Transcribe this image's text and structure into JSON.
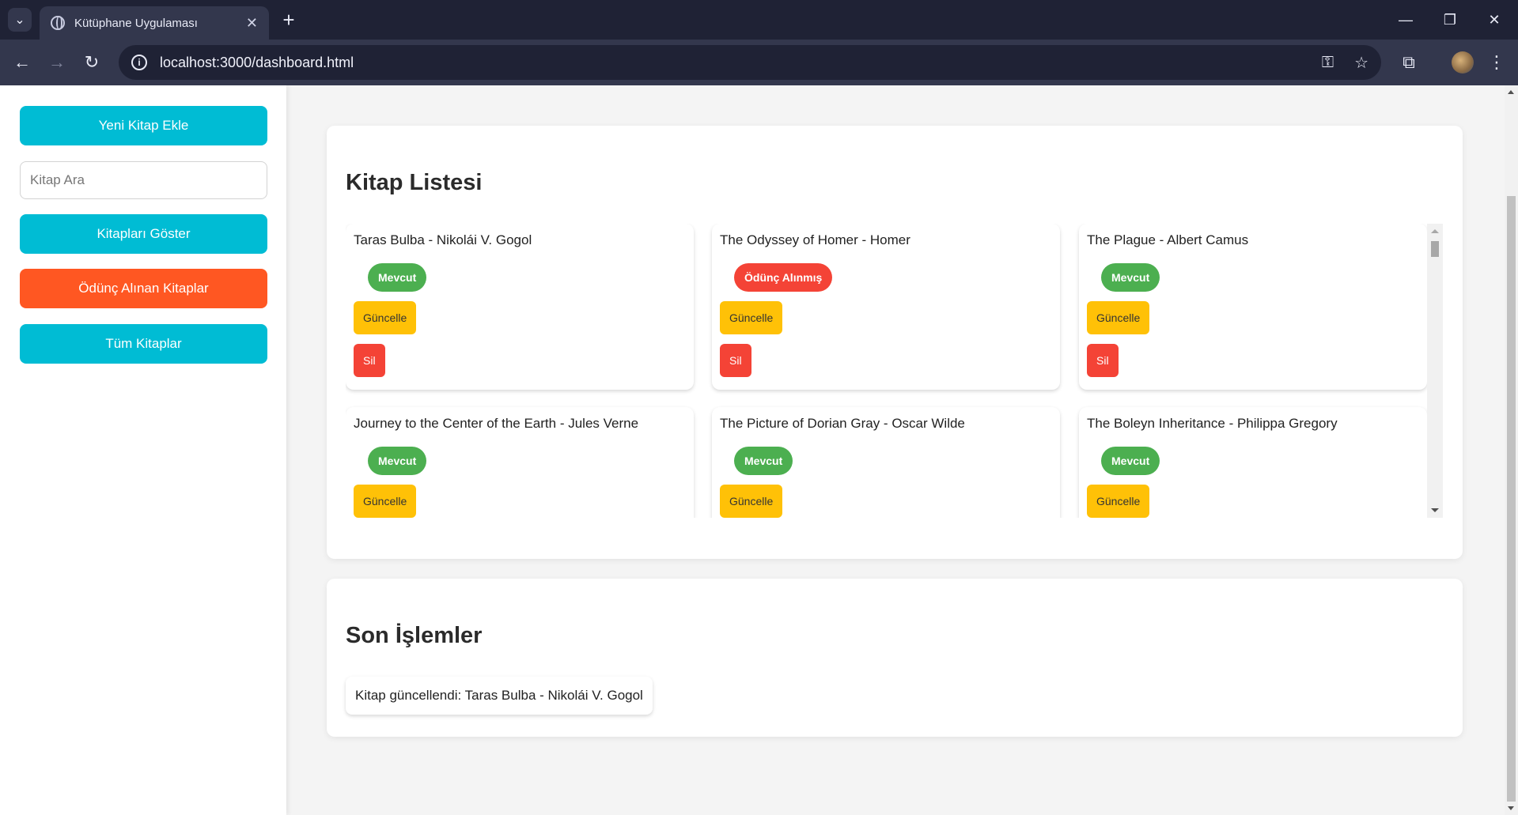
{
  "browser": {
    "tab_title": "Kütüphane Uygulaması",
    "tab_close": "✕",
    "new_tab": "+",
    "url": "localhost:3000/dashboard.html",
    "window": {
      "minimize": "—",
      "restore": "❐",
      "close": "✕"
    }
  },
  "sidebar": {
    "add_book": "Yeni Kitap Ekle",
    "search_placeholder": "Kitap Ara",
    "show_books": "Kitapları Göster",
    "borrowed_books": "Ödünç Alınan Kitaplar",
    "all_books": "Tüm Kitaplar"
  },
  "book_list": {
    "heading": "Kitap Listesi",
    "update_label": "Güncelle",
    "delete_label": "Sil",
    "books": [
      {
        "title": "Taras Bulba",
        "author": "Nikolái V. Gogol",
        "status": "Mevcut",
        "available": true
      },
      {
        "title": "The Odyssey of Homer",
        "author": "Homer",
        "status": "Ödünç Alınmış",
        "available": false
      },
      {
        "title": "The Plague",
        "author": "Albert Camus",
        "status": "Mevcut",
        "available": true
      },
      {
        "title": "Journey to the Center of the Earth",
        "author": "Jules Verne",
        "status": "Mevcut",
        "available": true
      },
      {
        "title": "The Picture of Dorian Gray",
        "author": "Oscar Wilde",
        "status": "Mevcut",
        "available": true
      },
      {
        "title": "The Boleyn Inheritance",
        "author": "Philippa Gregory",
        "status": "Mevcut",
        "available": true
      }
    ]
  },
  "recent": {
    "heading": "Son İşlemler",
    "items": [
      "Kitap güncellendi: Taras Bulba - Nikolái V. Gogol"
    ]
  },
  "colors": {
    "primary": "#00bcd4",
    "borrowed": "#ff5722",
    "available": "#4caf50",
    "unavailable": "#f44336",
    "update": "#ffc107",
    "delete": "#f44336"
  }
}
